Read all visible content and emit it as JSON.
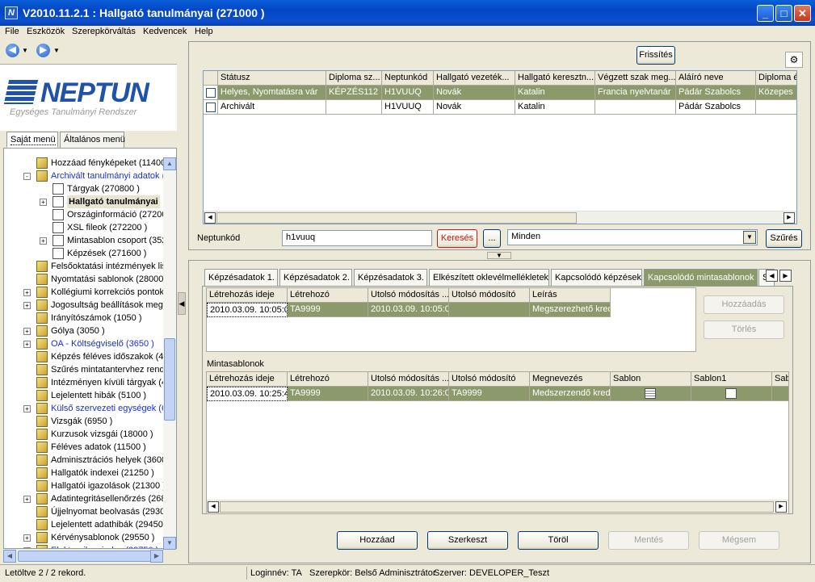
{
  "window": {
    "title": "V2010.11.2.1 : Hallgató tanulmányai (271000  )",
    "app_icon": "N"
  },
  "menu": [
    "File",
    "Eszközök",
    "Szerepkörváltás",
    "Kedvencek",
    "Help"
  ],
  "logo": {
    "brand": "NEPTUN",
    "subtitle": "Egységes Tanulmányi Rendszer"
  },
  "menu_tabs": [
    "Saját menü",
    "Általános menü"
  ],
  "tree": [
    {
      "label": "Hozzáad fényképeket (11400",
      "level": 1,
      "icon": "folder-doc",
      "exp": ""
    },
    {
      "label": "Archivált tanulmányi adatok (2",
      "level": 1,
      "icon": "folder-doc",
      "exp": "-",
      "color": "blue"
    },
    {
      "label": "Tárgyak (270800  )",
      "level": 2,
      "icon": "doc",
      "exp": ""
    },
    {
      "label": "Hallgató tanulmányai",
      "level": 2,
      "icon": "doc",
      "exp": "+",
      "bold": true
    },
    {
      "label": "Országinformáció (272000",
      "level": 2,
      "icon": "doc",
      "exp": ""
    },
    {
      "label": "XSL fileok (272200  )",
      "level": 2,
      "icon": "doc",
      "exp": ""
    },
    {
      "label": "Mintasablon csoport (352",
      "level": 2,
      "icon": "doc",
      "exp": "+"
    },
    {
      "label": "Képzések (271600  )",
      "level": 2,
      "icon": "doc",
      "exp": ""
    },
    {
      "label": "Felsőoktatási intézmények list",
      "level": 1,
      "icon": "folder-doc",
      "exp": ""
    },
    {
      "label": "Nyomtatási sablonok (280000",
      "level": 1,
      "icon": "folder-doc",
      "exp": ""
    },
    {
      "label": "Kollégiumi korrekciós pontok",
      "level": 1,
      "icon": "folder-doc",
      "exp": "+"
    },
    {
      "label": "Jogosultság beállítások megte",
      "level": 1,
      "icon": "folder-doc",
      "exp": "+"
    },
    {
      "label": "Irányítószámok (1050  )",
      "level": 1,
      "icon": "folder-doc",
      "exp": ""
    },
    {
      "label": "Gólya (3050  )",
      "level": 1,
      "icon": "folder-doc",
      "exp": "+"
    },
    {
      "label": "OA - Költségviselő (3650  )",
      "level": 1,
      "icon": "folder-doc",
      "exp": "+",
      "color": "blue"
    },
    {
      "label": "Képzés féléves időszakok (44",
      "level": 1,
      "icon": "folder-doc",
      "exp": ""
    },
    {
      "label": "Szűrés mintatantervhez rende",
      "level": 1,
      "icon": "folder-doc",
      "exp": ""
    },
    {
      "label": "Intézményen kívüli tárgyak (4",
      "level": 1,
      "icon": "folder-doc",
      "exp": ""
    },
    {
      "label": "Lejelentett hibák (5100  )",
      "level": 1,
      "icon": "folder-doc",
      "exp": ""
    },
    {
      "label": "Külső szervezeti egységek (67",
      "level": 1,
      "icon": "folder-doc",
      "exp": "+",
      "color": "blue"
    },
    {
      "label": "Vizsgák (6950  )",
      "level": 1,
      "icon": "folder-doc",
      "exp": ""
    },
    {
      "label": "Kurzusok vizsgái (18000  )",
      "level": 1,
      "icon": "folder-doc",
      "exp": ""
    },
    {
      "label": "Féléves adatok (11500  )",
      "level": 1,
      "icon": "folder-doc",
      "exp": ""
    },
    {
      "label": "Adminisztrációs helyek (3600",
      "level": 1,
      "icon": "folder-doc",
      "exp": ""
    },
    {
      "label": "Hallgatók indexei (21250  )",
      "level": 1,
      "icon": "folder-doc",
      "exp": ""
    },
    {
      "label": "Hallgatói igazolások (21300  )",
      "level": 1,
      "icon": "folder-doc",
      "exp": ""
    },
    {
      "label": "Adatintegritásellenőrzés (2685",
      "level": 1,
      "icon": "folder-doc",
      "exp": "+"
    },
    {
      "label": "Újjelnyomat beolvasás (29300",
      "level": 1,
      "icon": "folder-doc",
      "exp": ""
    },
    {
      "label": "Lejelentett adathibák (29450",
      "level": 1,
      "icon": "folder-doc",
      "exp": ""
    },
    {
      "label": "Kérvénysablonok (29550  )",
      "level": 1,
      "icon": "folder-doc",
      "exp": "+"
    },
    {
      "label": "Elektronikus index (29750  )",
      "level": 1,
      "icon": "folder-doc",
      "exp": "+",
      "color": "blue"
    }
  ],
  "top": {
    "refresh_label": "Frissítés",
    "columns": [
      "",
      "Státusz",
      "Diploma sz...",
      "Neptunkód",
      "Hallgató vezeték...",
      "Hallgató keresztn...",
      "Végzett szak meg...",
      "Aláíró neve",
      "Diploma é"
    ],
    "rows": [
      [
        "",
        "Helyes, Nyomtatásra vár",
        "KÉPZÉS112",
        "H1VUUQ",
        "Novák",
        "Katalin",
        "Francia nyelvtanár",
        "Pádár Szabolcs",
        "Közepes"
      ],
      [
        "",
        "Archivált",
        "",
        "H1VUUQ",
        "Novák",
        "Katalin",
        "",
        "Pádár Szabolcs",
        ""
      ]
    ],
    "filter": {
      "label": "Neptunkód",
      "value": "h1vuuq",
      "search_label": "Keresés",
      "more_label": "...",
      "combo_value": "Minden",
      "filter_label": "Szűrés"
    }
  },
  "tabs": [
    "Képzésadatok 1.",
    "Képzésadatok 2.",
    "Képzésadatok 3.",
    "Elkészített oklevélmellékletek",
    "Kapcsolódó képzések",
    "Kapcsolódó mintasablonok",
    "S"
  ],
  "active_tab": 5,
  "grid1": {
    "columns": [
      "Létrehozás ideje",
      "Létrehozó",
      "Utolsó módosítás ...",
      "Utolsó módosító",
      "Leírás"
    ],
    "rows": [
      [
        "2010.03.09. 10:05:0",
        "TA9999",
        "2010.03.09. 10:05:0",
        "",
        "Megszerezhető kred"
      ]
    ]
  },
  "side_buttons": {
    "add": "Hozzáadás",
    "delete": "Törlés"
  },
  "grid2": {
    "title": "Mintasablonok",
    "columns": [
      "Létrehozás ideje",
      "Létrehozó",
      "Utolsó módosítás ...",
      "Utolsó módosító",
      "Megnevezés",
      "Sablon",
      "Sablon1",
      "Sab"
    ],
    "rows": [
      [
        "2010.03.09. 10:25:4",
        "TA9999",
        "2010.03.09. 10:26:0",
        "TA9999",
        "Medszerzendő kredit",
        "",
        "",
        ""
      ]
    ]
  },
  "bottom_buttons": {
    "add": "Hozzáad",
    "edit": "Szerkeszt",
    "delete": "Töröl",
    "save": "Mentés",
    "cancel": "Mégsem"
  },
  "status": {
    "loaded": "Letöltve 2 / 2 rekord.",
    "login": "Loginnév: TA",
    "role": "Szerepkör: Belső Adminisztrátor",
    "server": "Szerver: DEVELOPER_Teszt"
  }
}
